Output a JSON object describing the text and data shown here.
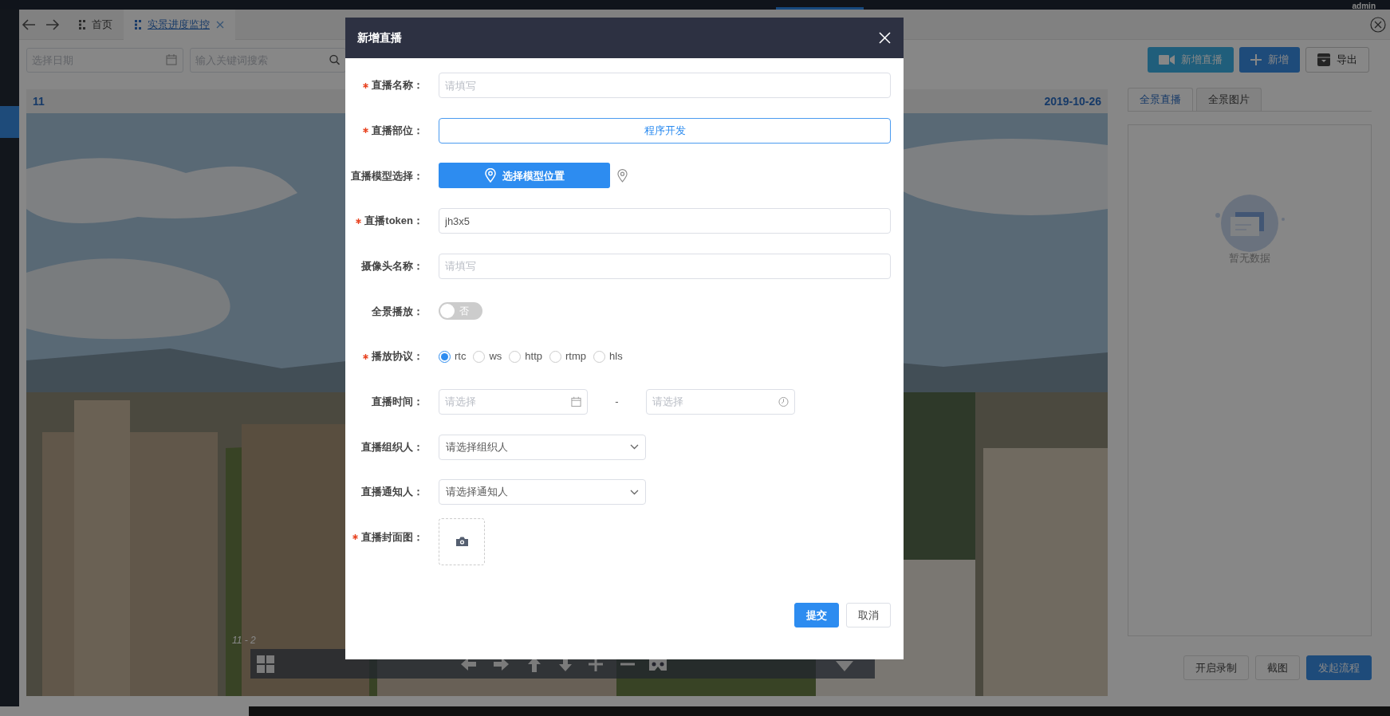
{
  "top_bar": {
    "user": "admin"
  },
  "tabs": [
    {
      "label": "首页",
      "selected": false,
      "closable": false
    },
    {
      "label": "实景进度监控",
      "selected": true,
      "closable": true
    }
  ],
  "toolbar": {
    "date_field": {
      "placeholder": "选择日期"
    },
    "search_field": {
      "placeholder": "输入关键词搜索"
    },
    "buttons": [
      {
        "label": "新增直播",
        "kind": "live"
      },
      {
        "label": "新增",
        "kind": "add"
      },
      {
        "label": "导出",
        "kind": "export"
      }
    ]
  },
  "viewer": {
    "title": "11",
    "date": "2019-10-26",
    "scene_label": "11 - 2"
  },
  "side_panel": {
    "tabs": [
      {
        "label": "全景直播",
        "selected": true
      },
      {
        "label": "全景图片",
        "selected": false
      }
    ],
    "empty_text": "暂无数据",
    "buttons": [
      {
        "label": "开启录制",
        "kind": "default"
      },
      {
        "label": "截图",
        "kind": "default"
      },
      {
        "label": "发起流程",
        "kind": "primary"
      }
    ]
  },
  "dialog": {
    "title": "新增直播",
    "fields": [
      {
        "kind": "text",
        "label": "直播名称：",
        "required": true,
        "placeholder": "请填写"
      },
      {
        "kind": "select_button",
        "label": "直播部位：",
        "required": true,
        "value": "程序开发"
      },
      {
        "kind": "model_button",
        "label": "直播模型选择：",
        "required": false,
        "button": "选择模型位置"
      },
      {
        "kind": "text",
        "label": "直播token：",
        "required": true,
        "value": "jh3x5"
      },
      {
        "kind": "text",
        "label": "摄像头名称：",
        "required": false,
        "placeholder": "请填写"
      },
      {
        "kind": "switch",
        "label": "全景播放：",
        "required": false,
        "on": false,
        "text": "否"
      },
      {
        "kind": "radio",
        "label": "播放协议：",
        "required": true,
        "options": [
          {
            "label": "rtc",
            "selected": true
          },
          {
            "label": "ws",
            "selected": false
          },
          {
            "label": "http",
            "selected": false
          },
          {
            "label": "rtmp",
            "selected": false
          },
          {
            "label": "hls",
            "selected": false
          }
        ]
      },
      {
        "kind": "time_range",
        "label": "直播时间：",
        "required": false,
        "start": {
          "placeholder": "请选择"
        },
        "separator": "-",
        "end": {
          "placeholder": "请选择"
        }
      },
      {
        "kind": "select",
        "label": "直播组织人：",
        "required": false,
        "value": "请选择组织人"
      },
      {
        "kind": "select",
        "label": "直播通知人：",
        "required": false,
        "value": "请选择通知人"
      },
      {
        "kind": "upload",
        "label": "直播封面图：",
        "required": true
      }
    ],
    "buttons": [
      {
        "label": "提交",
        "kind": "primary"
      },
      {
        "label": "取消",
        "kind": "default"
      }
    ]
  }
}
